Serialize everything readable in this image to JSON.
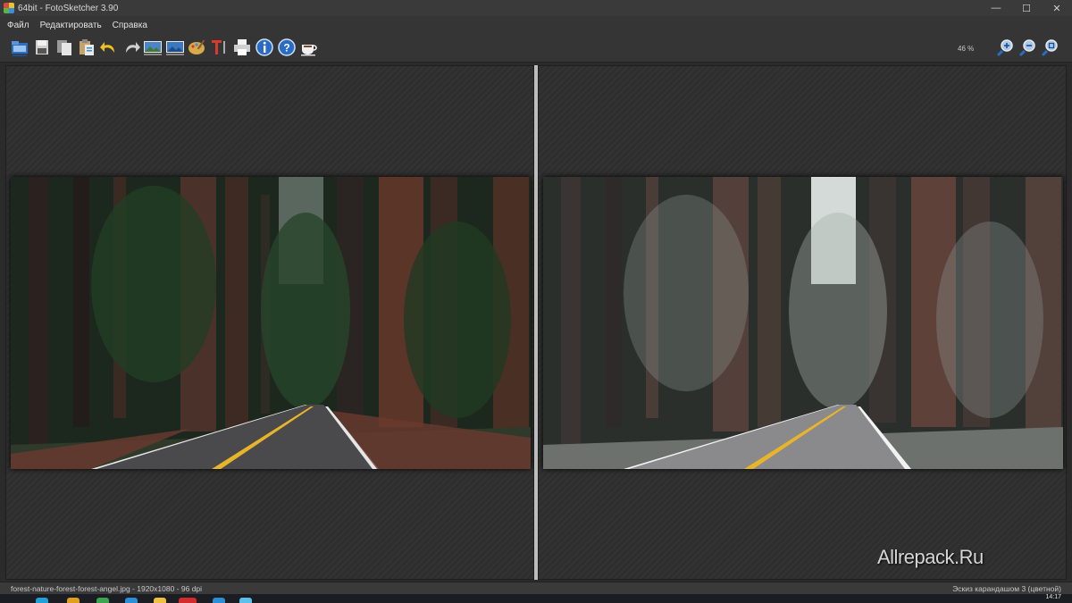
{
  "window": {
    "title": "64bit - FotoSketcher 3.90",
    "minimize": "—",
    "maximize": "☐",
    "close": "✕"
  },
  "menu": [
    {
      "label": "Файл"
    },
    {
      "label": "Редактировать"
    },
    {
      "label": "Справка"
    }
  ],
  "toolbar": {
    "buttons": [
      {
        "icon": "open-icon"
      },
      {
        "icon": "save-icon"
      },
      {
        "icon": "copy-icon"
      },
      {
        "icon": "paste-icon"
      },
      {
        "icon": "undo-icon"
      },
      {
        "icon": "redo-icon"
      },
      {
        "icon": "image-left-icon"
      },
      {
        "icon": "image-right-icon"
      },
      {
        "icon": "palette-icon"
      },
      {
        "icon": "text-icon"
      },
      {
        "icon": "print-icon"
      },
      {
        "icon": "info-icon"
      },
      {
        "icon": "help-icon"
      },
      {
        "icon": "coffee-icon"
      }
    ],
    "zoom_level": "46 %",
    "zoom_buttons": [
      {
        "icon": "zoom-in-icon"
      },
      {
        "icon": "zoom-out-icon"
      },
      {
        "icon": "zoom-fit-icon"
      }
    ]
  },
  "watermark": "Allrepack.Ru",
  "status": {
    "file_info": "forest-nature-forest-forest-angel.jpg - 1920x1080 - 96 dpi",
    "effect": "Эскиз карандашом 3 (цветной)"
  },
  "taskbar": {
    "time": "14:17"
  },
  "colors": {
    "panel_bg": "#2e2e2e",
    "splitter": "#bdbdbd",
    "road_line": "#e8b52a"
  }
}
